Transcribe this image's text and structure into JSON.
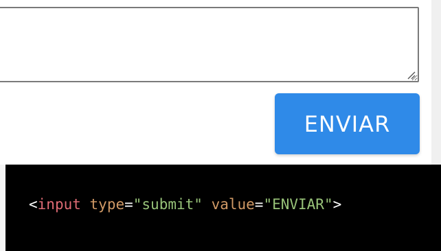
{
  "form": {
    "message_value": "",
    "submit_label": "ENVIAR"
  },
  "code": {
    "open": "<",
    "tag": "input",
    "attr1": "type",
    "eq1": "=",
    "val1": "\"submit\"",
    "attr2": "value",
    "eq2": "=",
    "val2": "\"ENVIAR\"",
    "close": ">"
  },
  "colors": {
    "button": "#2f8ae8",
    "code_bg": "#000000",
    "tag": "#e06c75",
    "attr": "#d19a66",
    "string": "#98c379"
  },
  "icons": {
    "resize": "resize-grip-icon"
  }
}
